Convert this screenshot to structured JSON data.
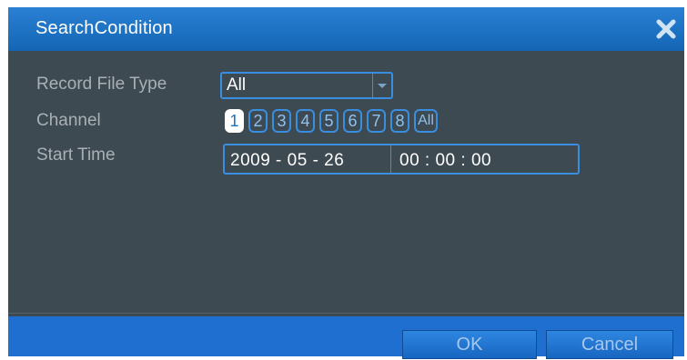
{
  "dialog": {
    "title": "SearchCondition"
  },
  "fields": {
    "record_type_label": "Record File Type",
    "record_type_value": "All",
    "channel_label": "Channel",
    "start_time_label": "Start Time",
    "start_date": "2009  - 05 - 26",
    "start_clock": "00 : 00 : 00"
  },
  "channels": [
    "1",
    "2",
    "3",
    "4",
    "5",
    "6",
    "7",
    "8",
    "All"
  ],
  "selected_channel": "1",
  "buttons": {
    "ok": "OK",
    "cancel": "Cancel"
  },
  "colors": {
    "titlebar": "#1a6fc6",
    "panel": "#3e4a52",
    "accent": "#3a8ee0",
    "label": "#a9b0b5"
  },
  "icons": {
    "close": "close-icon",
    "dropdown": "chevron-down-icon"
  }
}
